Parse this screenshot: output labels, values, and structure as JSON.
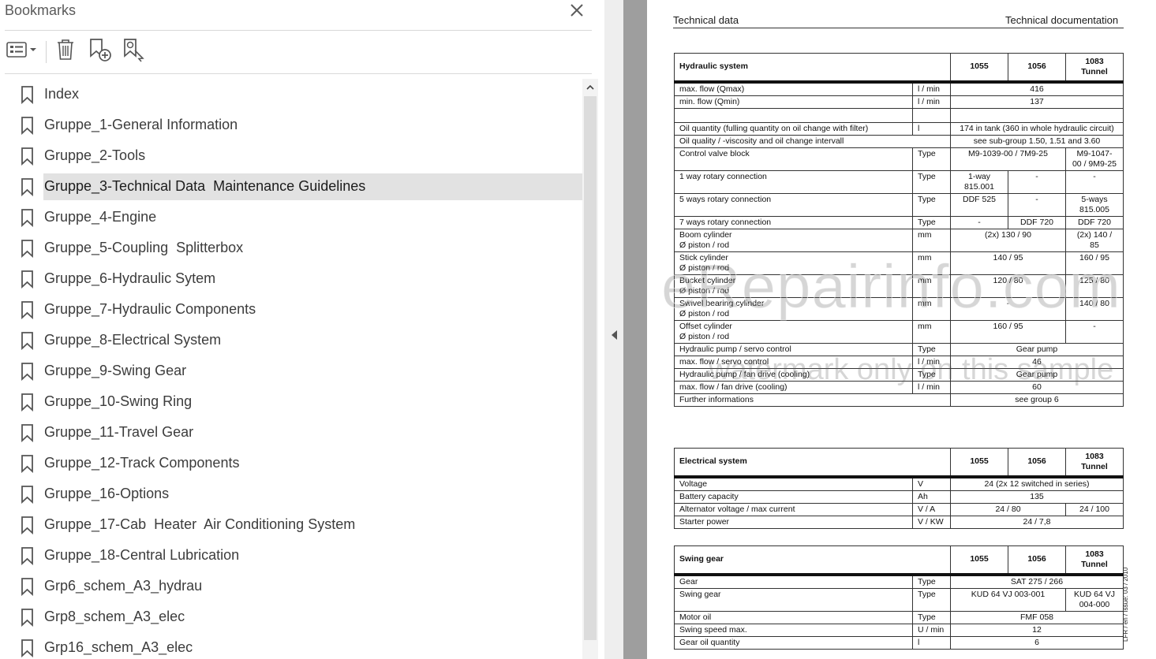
{
  "bookmarks_panel": {
    "title": "Bookmarks",
    "items": [
      {
        "label": "Index"
      },
      {
        "label": "Gruppe_1-General Information"
      },
      {
        "label": "Gruppe_2-Tools"
      },
      {
        "label": "Gruppe_3-Technical Data  Maintenance Guidelines",
        "selected": true
      },
      {
        "label": "Gruppe_4-Engine"
      },
      {
        "label": "Gruppe_5-Coupling  Splitterbox"
      },
      {
        "label": "Gruppe_6-Hydraulic Sytem"
      },
      {
        "label": "Gruppe_7-Hydraulic Components"
      },
      {
        "label": "Gruppe_8-Electrical System"
      },
      {
        "label": "Gruppe_9-Swing Gear"
      },
      {
        "label": "Gruppe_10-Swing Ring"
      },
      {
        "label": "Gruppe_11-Travel Gear"
      },
      {
        "label": "Gruppe_12-Track Components"
      },
      {
        "label": "Gruppe_16-Options"
      },
      {
        "label": "Gruppe_17-Cab  Heater  Air Conditioning System"
      },
      {
        "label": "Gruppe_18-Central Lubrication"
      },
      {
        "label": "Grp6_schem_A3_hydrau"
      },
      {
        "label": "Grp8_schem_A3_elec"
      },
      {
        "label": "Grp16_schem_A3_elec"
      }
    ],
    "icons": {
      "close": "close-icon",
      "options": "list-options-icon",
      "delete": "trash-icon",
      "new_bookmark": "add-bookmark-icon",
      "find_bookmark": "find-bookmark-icon",
      "item": "bookmark-icon"
    }
  },
  "document": {
    "header_left": "Technical data",
    "header_right": "Technical documentation",
    "side_note": "LFR / en / Issue: 03 / 2010",
    "watermark_main": "eRepairinfo.com",
    "watermark_sub": "watermark only on this sample",
    "hydraulic": {
      "title": "Hydraulic system",
      "col1": "1055",
      "col2": "1056",
      "col3a": "1083",
      "col3b": "Tunnel",
      "rows": {
        "maxflow": {
          "label": "max. flow (Qmax)",
          "unit": "l / min",
          "all": "416"
        },
        "minflow": {
          "label": "min. flow (Qmin)",
          "unit": "l / min",
          "all": "137"
        },
        "oilqty": {
          "label": "Oil quantity (fulling quantity on oil change with filter)",
          "unit": "l",
          "all": "174 in tank (360 in whole hydraulic circuit)"
        },
        "oilqual": {
          "label": "Oil quality / -viscosity and oil change intervall",
          "unit": "",
          "all": "see sub-group 1.50, 1.51 and 3.60"
        },
        "cvb": {
          "label": "Control valve block",
          "unit": "Type",
          "v12": "M9-1039-00 / 7M9-25",
          "v3a": "M9-1047-",
          "v3b": "00 / 9M9-25"
        },
        "rot1": {
          "label": "1 way rotary connection",
          "unit": "Type",
          "v1a": "1-way",
          "v1b": "815.001",
          "v2": "-",
          "v3": "-"
        },
        "rot5": {
          "label": "5 ways rotary connection",
          "unit": "Type",
          "v1": "DDF 525",
          "v2": "-",
          "v3a": "5-ways",
          "v3b": "815.005"
        },
        "rot7": {
          "label": "7 ways rotary connection",
          "unit": "Type",
          "v1": "-",
          "v2": "DDF 720",
          "v3": "DDF 720"
        },
        "boom": {
          "label_a": "Boom cylinder",
          "label_b": "Ø piston / rod",
          "unit": "mm",
          "v12": "(2x) 130 / 90",
          "v3a": "(2x) 140 /",
          "v3b": "85"
        },
        "stick": {
          "label_a": "Stick cylinder",
          "label_b": "Ø piston / rod",
          "unit": "mm",
          "v12": "140 / 95",
          "v3": "160 / 95"
        },
        "bucket": {
          "label_a": "Bucket cylinder",
          "label_b": "Ø piston / rod",
          "unit": "mm",
          "v12": "120 / 80",
          "v3": "125 / 80"
        },
        "swivel": {
          "label_a": "Swivel bearing cylinder",
          "label_b": "Ø piston / rod",
          "unit": "mm",
          "v12": "-",
          "v3": "140 / 80"
        },
        "offset": {
          "label_a": "Offset cylinder",
          "label_b": "Ø piston / rod",
          "unit": "mm",
          "v12": "160 / 95",
          "v3": "-"
        },
        "pump_servo": {
          "label": "Hydraulic pump / servo control",
          "unit": "Type",
          "all": "Gear pump"
        },
        "flow_servo": {
          "label": "max. flow / servo control",
          "unit": "l / min",
          "all": "46"
        },
        "pump_fan": {
          "label": "Hydraulic pump / fan drive (cooling)",
          "unit": "Type",
          "all": "Gear pump"
        },
        "flow_fan": {
          "label": "max. flow / fan drive (cooling)",
          "unit": "l / min",
          "all": "60"
        },
        "further": {
          "label": "Further informations",
          "unit": "",
          "all": "see group 6"
        }
      }
    },
    "electrical": {
      "title": "Electrical system",
      "col1": "1055",
      "col2": "1056",
      "col3a": "1083",
      "col3b": "Tunnel",
      "rows": {
        "voltage": {
          "label": "Voltage",
          "unit": "V",
          "all": "24 (2x 12 switched in series)"
        },
        "battery": {
          "label": "Battery capacity",
          "unit": "Ah",
          "all": "135"
        },
        "alternator": {
          "label": "Alternator voltage / max current",
          "unit": "V / A",
          "v12": "24 / 80",
          "v3": "24 / 100"
        },
        "starter": {
          "label": "Starter power",
          "unit": "V / KW",
          "all": "24 / 7,8"
        }
      }
    },
    "swing": {
      "title": "Swing gear",
      "col1": "1055",
      "col2": "1056",
      "col3a": "1083",
      "col3b": "Tunnel",
      "rows": {
        "gear": {
          "label": "Gear",
          "unit": "Type",
          "all": "SAT 275 / 266"
        },
        "swinggear": {
          "label": "Swing gear",
          "unit": "Type",
          "v12": "KUD 64 VJ 003-001",
          "v3a": "KUD 64 VJ",
          "v3b": "004-000"
        },
        "motoroil": {
          "label": "Motor oil",
          "unit": "Type",
          "all": "FMF 058"
        },
        "speed": {
          "label": "Swing speed max.",
          "unit": "U / min",
          "all": "12"
        },
        "gearoil": {
          "label": "Gear oil quantity",
          "unit": "l",
          "all": "6"
        }
      }
    }
  }
}
